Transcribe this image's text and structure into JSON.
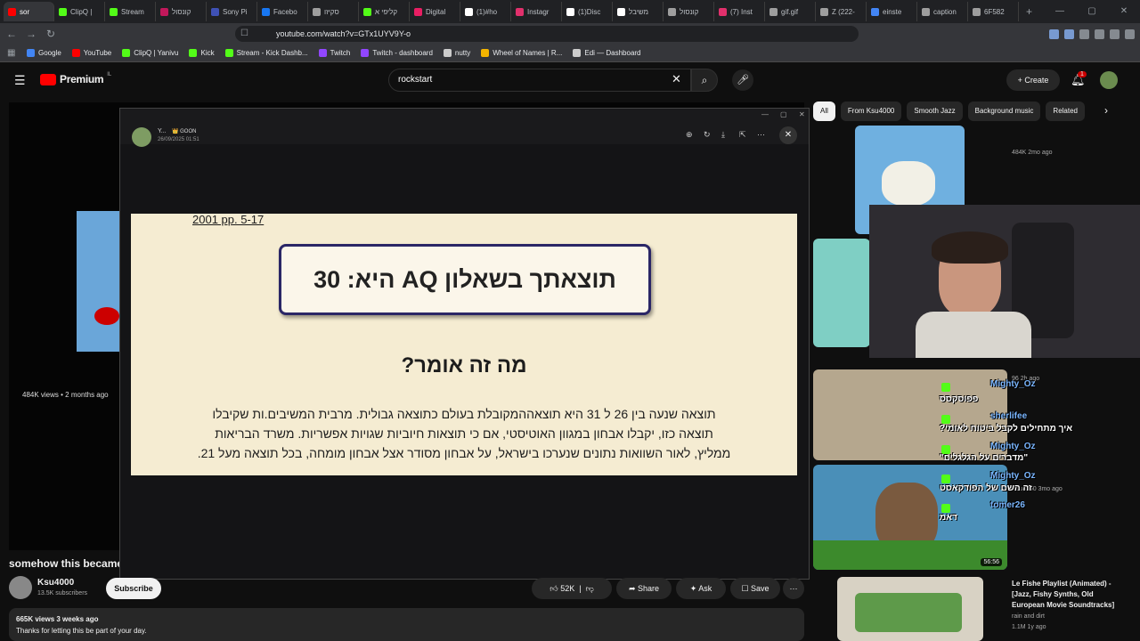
{
  "browser": {
    "tabs": [
      {
        "label": "sor",
        "color": "#ff0000"
      },
      {
        "label": "ClipQ |",
        "color": "#53fc18"
      },
      {
        "label": "Stream",
        "color": "#53fc18"
      },
      {
        "label": "קונסול",
        "color": "#c2185b"
      },
      {
        "label": "Sony Pi",
        "color": "#3f51b5"
      },
      {
        "label": "Facebo",
        "color": "#1877f2"
      },
      {
        "label": "סקיזו",
        "color": "#9e9e9e"
      },
      {
        "label": "קליפי א",
        "color": "#53fc18"
      },
      {
        "label": "Digital",
        "color": "#e91e63"
      },
      {
        "label": "(1)#ho",
        "color": "#ffffff"
      },
      {
        "label": "Instagr",
        "color": "#e1306c"
      },
      {
        "label": "(1)Disc",
        "color": "#ffffff"
      },
      {
        "label": "משיבל",
        "color": "#ffffff"
      },
      {
        "label": "קונסול",
        "color": "#9e9e9e"
      },
      {
        "label": "(7) Inst",
        "color": "#e1306c"
      },
      {
        "label": "gif.gif",
        "color": "#9e9e9e"
      },
      {
        "label": "Z (222-",
        "color": "#9e9e9e"
      },
      {
        "label": "einste",
        "color": "#4285f4"
      },
      {
        "label": "caption",
        "color": "#9e9e9e"
      },
      {
        "label": "6F582",
        "color": "#9e9e9e"
      }
    ],
    "new_tab": "+",
    "url": "youtube.com/watch?v=GTx1UYV9Y-o",
    "bookmarks": [
      {
        "label": "Google",
        "color": "#4285f4"
      },
      {
        "label": "YouTube",
        "color": "#ff0000"
      },
      {
        "label": "ClipQ | Yanivu",
        "color": "#53fc18"
      },
      {
        "label": "Kick",
        "color": "#53fc18"
      },
      {
        "label": "Stream - Kick Dashb...",
        "color": "#53fc18"
      },
      {
        "label": "Twitch",
        "color": "#9146ff"
      },
      {
        "label": "Twitch - dashboard",
        "color": "#9146ff"
      },
      {
        "label": "nutty",
        "color": "#cccccc"
      },
      {
        "label": "Wheel of Names | R...",
        "color": "#f4b400"
      },
      {
        "label": "Edi — Dashboard",
        "color": "#cccccc"
      }
    ]
  },
  "youtube": {
    "logo": "Premium",
    "logo_region": "IL",
    "search_query": "rockstart",
    "create_label": "Create",
    "notif_count": "1",
    "chips": [
      "All",
      "From Ksu4000",
      "Smooth Jazz",
      "Background music",
      "Related"
    ],
    "video": {
      "title": "somehow this became",
      "channel": "Ksu4000",
      "subscribers": "13.5K subscribers",
      "subscribe_label": "Subscribe",
      "likes": "52K",
      "share_label": "Share",
      "ask_label": "Ask",
      "save_label": "Save",
      "views_date": "665K views  3 weeks ago",
      "description": "Thanks for letting this be part of your day.",
      "left_meta": "484K views • 2 months ago"
    },
    "sidebar": [
      {
        "meta": "484K  2mo ago"
      },
      {
        "meta": "96  2h ago"
      },
      {
        "meta": "Ksu4000  3mo ago",
        "duration": "56:56"
      },
      {
        "title": "Le Fishe Playlist (Animated) - [Jazz, Fishy Synths, Old European Movie Soundtracks]",
        "channel": "rain and dirt",
        "meta": "1.1M  1y ago"
      }
    ]
  },
  "modal": {
    "user": "Y...",
    "tag": "GOON",
    "timestamp": "26/09/2025 01:51",
    "slide_ref": "2001 pp. 5-17",
    "result": "תוצאתך בשאלון AQ היא: 30",
    "question": "מה זה אומר?",
    "body": [
      "תוצאה שנעה בין 26 ל 31 היא תוצאההמקובלת בעולם כתוצאה גבולית. מרבית המשיבים.ות שקיבלו",
      "תוצאה כזו, יקבלו אבחון במגוון האוטיסטי, אם כי תוצאות חיוביות שגויות אפשריות. משרד הבריאות",
      "ממליץ, לאור השוואות נתונים שנערכו בישראל, על אבחון מסודר אצל אבחון מומחה, בכל תוצאה מעל 21."
    ]
  },
  "chat": [
    {
      "user": "Mighty_Oz",
      "msg": "פפוסקסס"
    },
    {
      "user": "sherlifee",
      "msg": "איך מתחילים לקבל ביטוח לאומי?"
    },
    {
      "user": "Mighty_Oz",
      "msg": "\"מדברים על הגלגלים\""
    },
    {
      "user": "Mighty_Oz",
      "msg": "זה השם של הפודקאסט"
    },
    {
      "user": "tomer26",
      "msg": "דאמ"
    }
  ],
  "colors": {
    "yt_red": "#ff0000",
    "kick_green": "#53fc18",
    "chat_user": "#7ab6ff"
  }
}
